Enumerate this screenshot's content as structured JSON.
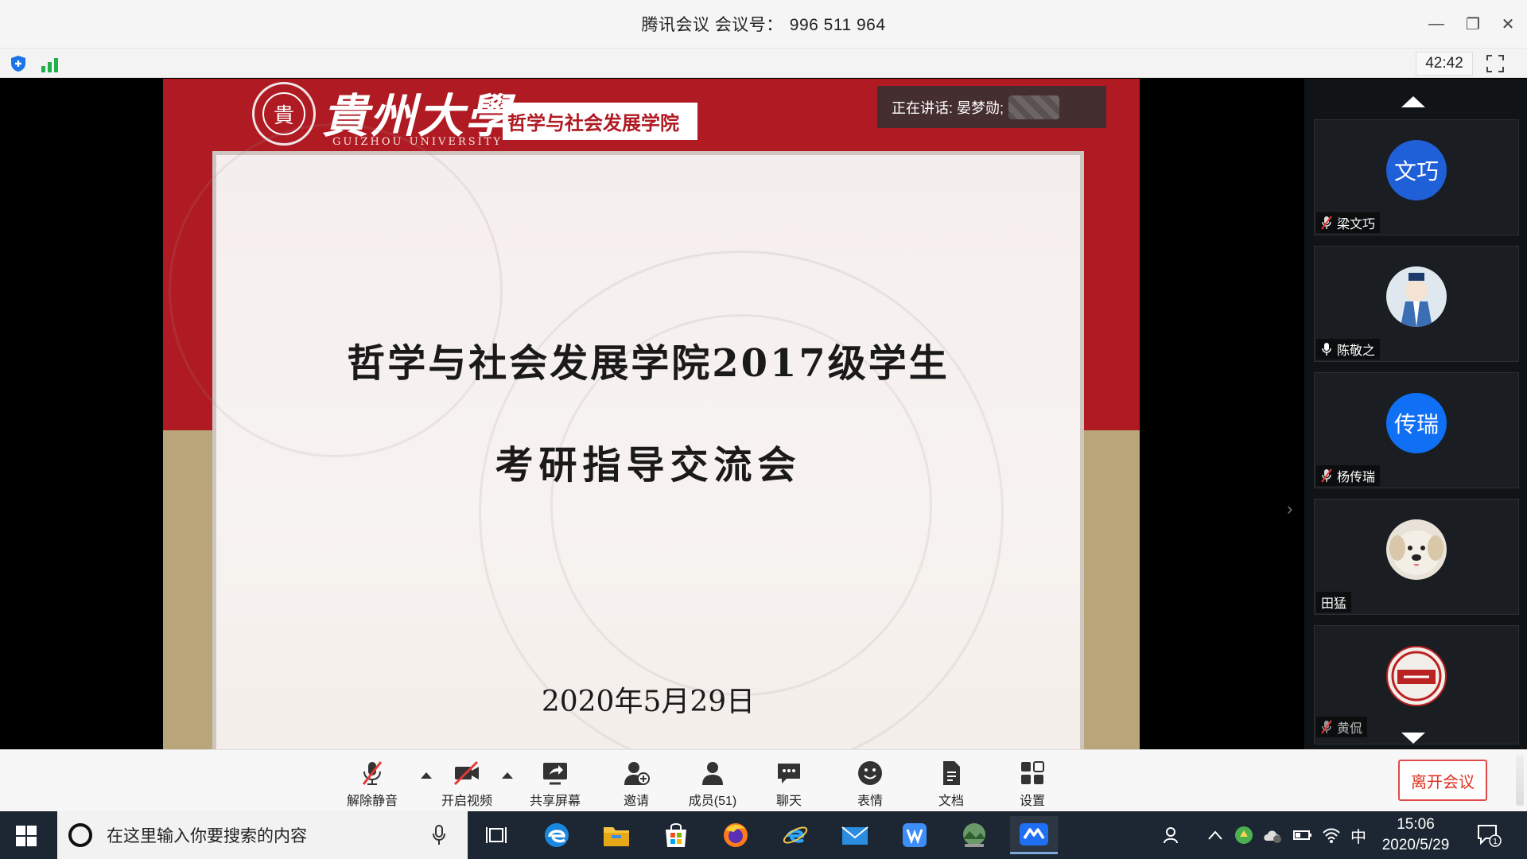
{
  "window": {
    "title": "腾讯会议 会议号：",
    "meeting_number": "996 511 964",
    "minimize": "—",
    "restore": "❐",
    "close": "✕"
  },
  "infobar": {
    "timer": "42:42"
  },
  "slide": {
    "university_cn": "貴州大學",
    "university_en": "GUIZHOU UNIVERSITY",
    "seal_char": "貴",
    "college_label": "哲学与社会发展学院",
    "title_line1": "哲学与社会发展学院2017级学生",
    "title_line2": "考研指导交流会",
    "date": "2020年5月29日"
  },
  "speaking": {
    "label": "正在讲话: 晏梦勋;"
  },
  "participants": [
    {
      "name": "梁文巧",
      "avatar_text": "文巧",
      "avatar_type": "initials",
      "muted": true
    },
    {
      "name": "陈敬之",
      "avatar_text": "",
      "avatar_type": "image",
      "muted": false
    },
    {
      "name": "杨传瑞",
      "avatar_text": "传瑞",
      "avatar_type": "initials",
      "muted": true
    },
    {
      "name": "田猛",
      "avatar_text": "",
      "avatar_type": "image",
      "muted": false
    },
    {
      "name": "黄侃",
      "avatar_text": "",
      "avatar_type": "image",
      "muted": true
    }
  ],
  "toolbar": {
    "unmute": "解除静音",
    "start_video": "开启视频",
    "share_screen": "共享屏幕",
    "invite": "邀请",
    "members": "成员(51)",
    "chat": "聊天",
    "reactions": "表情",
    "docs": "文档",
    "settings": "设置",
    "leave": "离开会议"
  },
  "taskbar": {
    "search_placeholder": "在这里输入你要搜索的内容",
    "ime": "中",
    "time": "15:06",
    "date": "2020/5/29",
    "notification_count": "1"
  },
  "colors": {
    "slide_red": "#b01a22",
    "slide_gold": "#b9a57a",
    "avatar_blue": "#1f60d8",
    "leave_red": "#e0301e",
    "signal_green": "#21b04b"
  }
}
